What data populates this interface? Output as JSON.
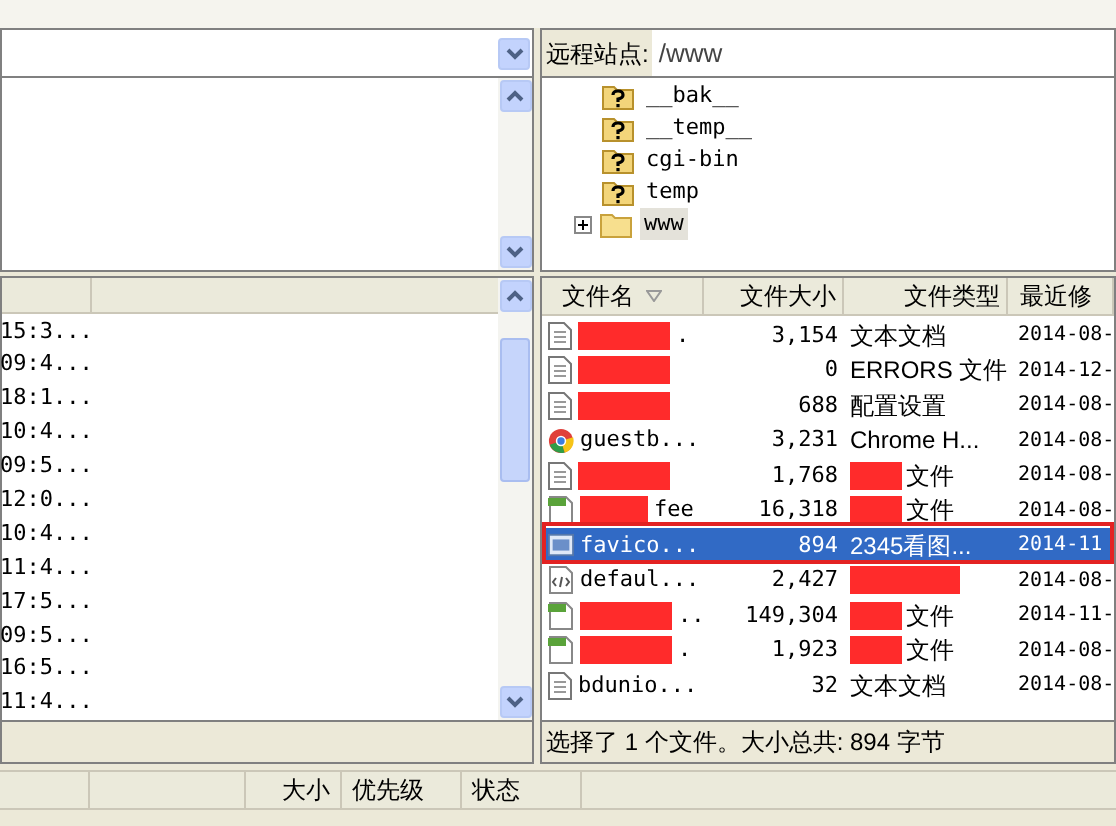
{
  "local_list": {
    "rows": [
      {
        "modified": "15:3..."
      },
      {
        "modified": "09:4..."
      },
      {
        "modified": "18:1..."
      },
      {
        "modified": "10:4..."
      },
      {
        "modified": "09:5..."
      },
      {
        "modified": "12:0..."
      },
      {
        "modified": "10:4..."
      },
      {
        "modified": "11:4..."
      },
      {
        "modified": "17:5..."
      },
      {
        "modified": "09:5..."
      },
      {
        "modified": "16:5..."
      },
      {
        "modified": "11:4..."
      }
    ]
  },
  "remote_site": {
    "label": "远程站点:",
    "path": "/www"
  },
  "remote_tree": {
    "items": [
      {
        "name": "__bak__",
        "kind": "unknown",
        "selected": false
      },
      {
        "name": "__temp__",
        "kind": "unknown",
        "selected": false
      },
      {
        "name": "cgi-bin",
        "kind": "unknown",
        "selected": false
      },
      {
        "name": "temp",
        "kind": "unknown",
        "selected": false
      },
      {
        "name": "www",
        "kind": "folder",
        "expanded": false,
        "selected": true
      }
    ]
  },
  "remote_list": {
    "columns": [
      {
        "label": "文件名",
        "sorted": true
      },
      {
        "label": "文件大小",
        "sorted": false
      },
      {
        "label": "文件类型",
        "sorted": false
      },
      {
        "label": "最近修",
        "sorted": false
      }
    ],
    "rows": [
      {
        "name": ".",
        "name_redacted": true,
        "kind": "text",
        "size": "3,154",
        "type": "文本文档",
        "type_redacted": false,
        "modified": "2014-08-",
        "selected": false,
        "outlined": false
      },
      {
        "name_redacted": true,
        "kind": "text",
        "size": "0",
        "type": "ERRORS 文件",
        "type_redacted": false,
        "modified": "2014-12-",
        "selected": false,
        "outlined": false
      },
      {
        "name_redacted": true,
        "kind": "text",
        "size": "688",
        "type": "配置设置",
        "type_redacted": false,
        "modified": "2014-08-",
        "selected": false,
        "outlined": false
      },
      {
        "name": "guestb...",
        "name_redacted": false,
        "kind": "chrome",
        "size": "3,231",
        "type": "Chrome H...",
        "type_redacted": false,
        "modified": "2014-08-",
        "selected": false,
        "outlined": false
      },
      {
        "name_redacted": true,
        "kind": "text",
        "size": "1,768",
        "type": "文件",
        "type_redacted": true,
        "modified": "2014-08-",
        "selected": false,
        "outlined": false
      },
      {
        "name": "fee",
        "name_redacted": true,
        "kind": "script",
        "size": "16,318",
        "type": "文件",
        "type_redacted": true,
        "modified": "2014-08-",
        "selected": false,
        "outlined": false
      },
      {
        "name": "favico...",
        "name_redacted": false,
        "kind": "image",
        "size": "894",
        "type": "2345看图...",
        "type_redacted": false,
        "modified": "2014-11",
        "selected": true,
        "outlined": true
      },
      {
        "name": "defaul...",
        "name_redacted": false,
        "kind": "html",
        "size": "2,427",
        "type_redacted": true,
        "modified": "2014-08-",
        "selected": false,
        "outlined": false
      },
      {
        "name": "..",
        "name_redacted": true,
        "kind": "script",
        "size": "149,304",
        "type": "文件",
        "type_redacted": true,
        "modified": "2014-11-",
        "selected": false,
        "outlined": false
      },
      {
        "name": ".",
        "name_redacted": true,
        "kind": "script",
        "size": "1,923",
        "type": "文件",
        "type_redacted": true,
        "modified": "2014-08-",
        "selected": false,
        "outlined": false
      },
      {
        "name": "bdunio...",
        "name_redacted": false,
        "kind": "text",
        "size": "32",
        "type": "文本文档",
        "type_redacted": false,
        "modified": "2014-08-",
        "selected": false,
        "outlined": false
      }
    ]
  },
  "remote_status": "选择了 1 个文件。大小总共: 894 字节",
  "queue": {
    "columns": [
      "大小",
      "优先级",
      "状态"
    ]
  }
}
